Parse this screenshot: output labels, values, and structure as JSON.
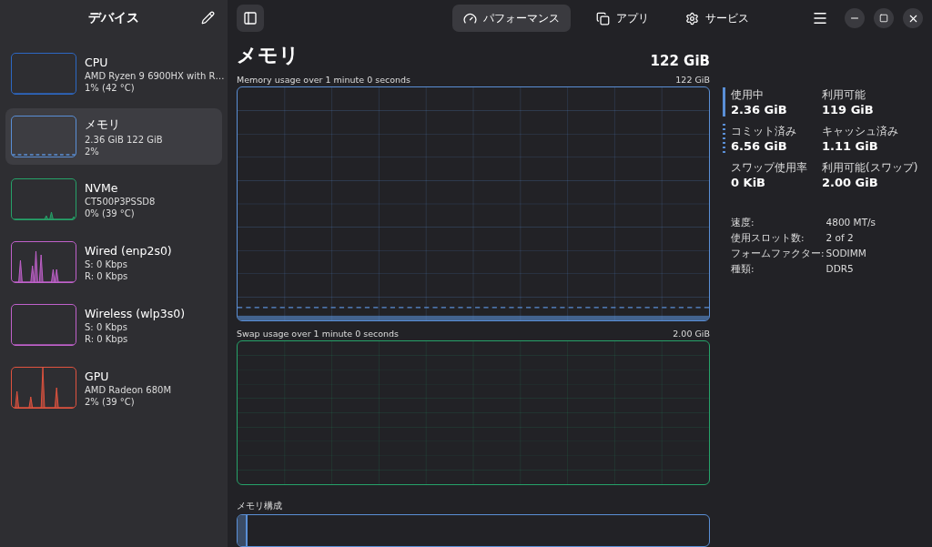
{
  "sidebar": {
    "title": "デバイス",
    "devices": [
      {
        "name": "CPU",
        "line1": "AMD Ryzen 9 6900HX with R…",
        "line2": "1% (42 °C)",
        "color": "#2d68c4",
        "selected": false
      },
      {
        "name": "メモリ",
        "line1": "2.36 GiB 122 GiB",
        "line2": "2%",
        "color": "#5a8fd6",
        "selected": true
      },
      {
        "name": "NVMe",
        "line1": "CT500P3PSSD8",
        "line2": "0% (39 °C)",
        "color": "#26a269",
        "selected": false
      },
      {
        "name": "Wired (enp2s0)",
        "line1": "S: 0 Kbps",
        "line2": "R: 0 Kbps",
        "color": "#c061cb",
        "selected": false
      },
      {
        "name": "Wireless (wlp3s0)",
        "line1": "S: 0 Kbps",
        "line2": "R: 0 Kbps",
        "color": "#c061cb",
        "selected": false
      },
      {
        "name": "GPU",
        "line1": "AMD Radeon 680M",
        "line2": "2% (39 °C)",
        "color": "#e0533f",
        "selected": false
      }
    ]
  },
  "tabs": [
    {
      "label": "パフォーマンス",
      "selected": true
    },
    {
      "label": "アプリ",
      "selected": false
    },
    {
      "label": "サービス",
      "selected": false
    }
  ],
  "page": {
    "title": "メモリ",
    "total": "122 GiB",
    "memory_graph": {
      "caption": "Memory usage over 1 minute 0 seconds",
      "max": "122 GiB"
    },
    "swap_graph": {
      "caption": "Swap usage over 1 minute 0 seconds",
      "max": "2.00 GiB"
    },
    "composition": {
      "caption": "メモリ構成",
      "level": 0.018
    }
  },
  "stats": [
    {
      "label": "使用中",
      "value": "2.36 GiB",
      "kind": "solid"
    },
    {
      "label": "利用可能",
      "value": "119 GiB",
      "kind": "none"
    },
    {
      "label": "コミット済み",
      "value": "6.56 GiB",
      "kind": "dotted"
    },
    {
      "label": "キャッシュ済み",
      "value": "1.11 GiB",
      "kind": "none"
    },
    {
      "label": "スワップ使用率",
      "value": "0 KiB",
      "kind": "none"
    },
    {
      "label": "利用可能(スワップ)",
      "value": "2.00 GiB",
      "kind": "none"
    }
  ],
  "details": [
    {
      "label": "速度:",
      "value": "4800 MT/s"
    },
    {
      "label": "使用スロット数:",
      "value": "2 of 2"
    },
    {
      "label": "フォームファクター:",
      "value": "SODIMM"
    },
    {
      "label": "種類:",
      "value": "DDR5"
    }
  ]
}
